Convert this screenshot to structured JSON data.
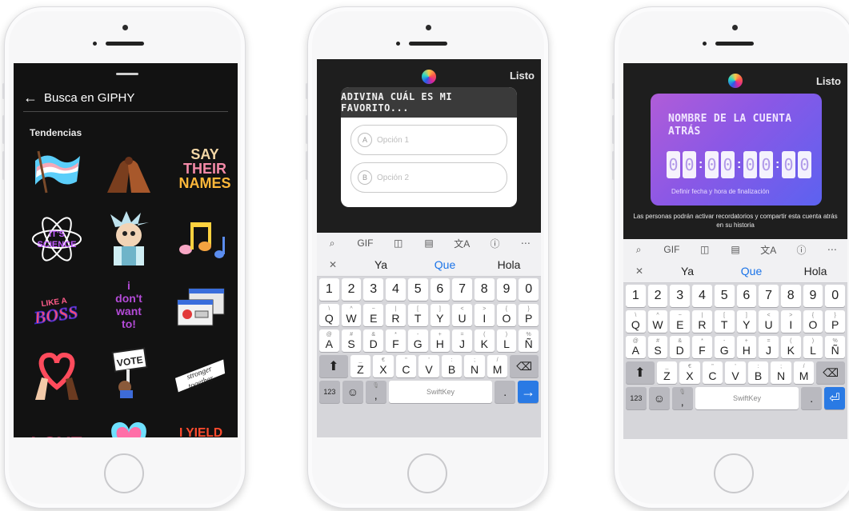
{
  "phone1": {
    "search_title": "Busca en GIPHY",
    "section": "Tendencias",
    "stickers": [
      {
        "icon": "trans-flag-sticker",
        "label": ""
      },
      {
        "icon": "pinky-promise-hands-sticker",
        "label": ""
      },
      {
        "icon": "say-their-names-sticker",
        "line1": "SAY",
        "line2": "THEIR",
        "line3": "NAMES"
      },
      {
        "icon": "its-science-sticker",
        "label": "IT'S SCIENCE"
      },
      {
        "icon": "rick-sticker",
        "label": ""
      },
      {
        "icon": "music-notes-sticker",
        "label": "♪♫"
      },
      {
        "icon": "boss-sticker",
        "label": "BOSS"
      },
      {
        "icon": "dont-want-to-sticker",
        "label": "i don't want to!"
      },
      {
        "icon": "windows-sticker",
        "label": ""
      },
      {
        "icon": "heart-hands-sticker",
        "label": ""
      },
      {
        "icon": "vote-sign-sticker",
        "label": "VOTE"
      },
      {
        "icon": "stronger-together-sticker",
        "label": "stronger together"
      },
      {
        "icon": "love-sticker",
        "label": "LOVE"
      },
      {
        "icon": "heart-sticker",
        "label": ""
      },
      {
        "icon": "yield-sticker",
        "label": "I YIELD"
      }
    ]
  },
  "phone2": {
    "done": "Listo",
    "question": "ADIVINA CUÁL ES MI FAVORITO...",
    "option1_letter": "A",
    "option1": "Opción 1",
    "option2_letter": "B",
    "option2": "Opción 2"
  },
  "phone3": {
    "done": "Listo",
    "countdown_title_1": "NOMBRE DE LA CUENTA",
    "countdown_title_2": "ATRÁS",
    "digits": [
      "0",
      "0",
      "0",
      "0",
      "0",
      "0",
      "0",
      "0"
    ],
    "subtitle": "Definir fecha y hora de finalización",
    "note": "Las personas podrán activar recordatorios y compartir esta cuenta atrás en su historia"
  },
  "keyboard": {
    "suggestions": [
      "Ya",
      "Que",
      "Hola"
    ],
    "number_row": [
      "1",
      "2",
      "3",
      "4",
      "5",
      "6",
      "7",
      "8",
      "9",
      "0"
    ],
    "row1": [
      [
        "Q",
        "\\"
      ],
      [
        "W",
        "^"
      ],
      [
        "E",
        "~"
      ],
      [
        "R",
        "|"
      ],
      [
        "T",
        "["
      ],
      [
        "Y",
        "]"
      ],
      [
        "U",
        "<"
      ],
      [
        "I",
        ">"
      ],
      [
        "O",
        "{"
      ],
      [
        "P",
        "}"
      ]
    ],
    "row2": [
      [
        "A",
        "@"
      ],
      [
        "S",
        "#"
      ],
      [
        "D",
        "&"
      ],
      [
        "F",
        "*"
      ],
      [
        "G",
        "-"
      ],
      [
        "H",
        "+"
      ],
      [
        "J",
        "="
      ],
      [
        "K",
        "("
      ],
      [
        "L",
        ")"
      ],
      [
        "Ñ",
        "%"
      ]
    ],
    "row3": [
      [
        "Z",
        "_"
      ],
      [
        "X",
        "€"
      ],
      [
        "C",
        "\""
      ],
      [
        "V",
        "'"
      ],
      [
        "B",
        ":"
      ],
      [
        "N",
        ";"
      ],
      [
        "M",
        "/"
      ]
    ],
    "numbers_key": "123",
    "space_label": "SwiftKey"
  },
  "colors": {
    "keyboard_blue": "#2a7ae4",
    "suggestion_blue": "#1a73e8",
    "countdown_gradient_start": "#b05cd8",
    "countdown_gradient_end": "#5c62f0"
  }
}
